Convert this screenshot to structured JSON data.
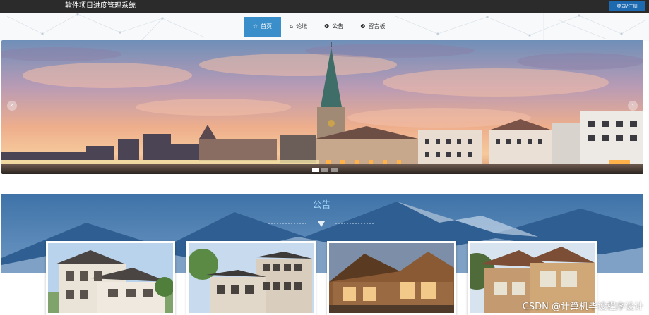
{
  "header": {
    "site_title": "软件项目进度管理系统",
    "login_label": "登录/注册"
  },
  "nav": {
    "items": [
      {
        "label": "首页",
        "icon": "star-icon",
        "active": true
      },
      {
        "label": "论坛",
        "icon": "home-icon",
        "active": false
      },
      {
        "label": "公告",
        "icon": "info-circle-icon",
        "active": false
      },
      {
        "label": "留言板",
        "icon": "question-circle-icon",
        "active": false
      }
    ]
  },
  "banner": {
    "prev_glyph": "‹",
    "next_glyph": "›",
    "slides": 3,
    "active_slide": 1
  },
  "announcements": {
    "title": "公告"
  },
  "watermark": "CSDN @计算机毕设程序设计",
  "colors": {
    "topbar": "#2b2b2b",
    "accent": "#3a8ec9",
    "login_button": "#1e6ab0"
  }
}
